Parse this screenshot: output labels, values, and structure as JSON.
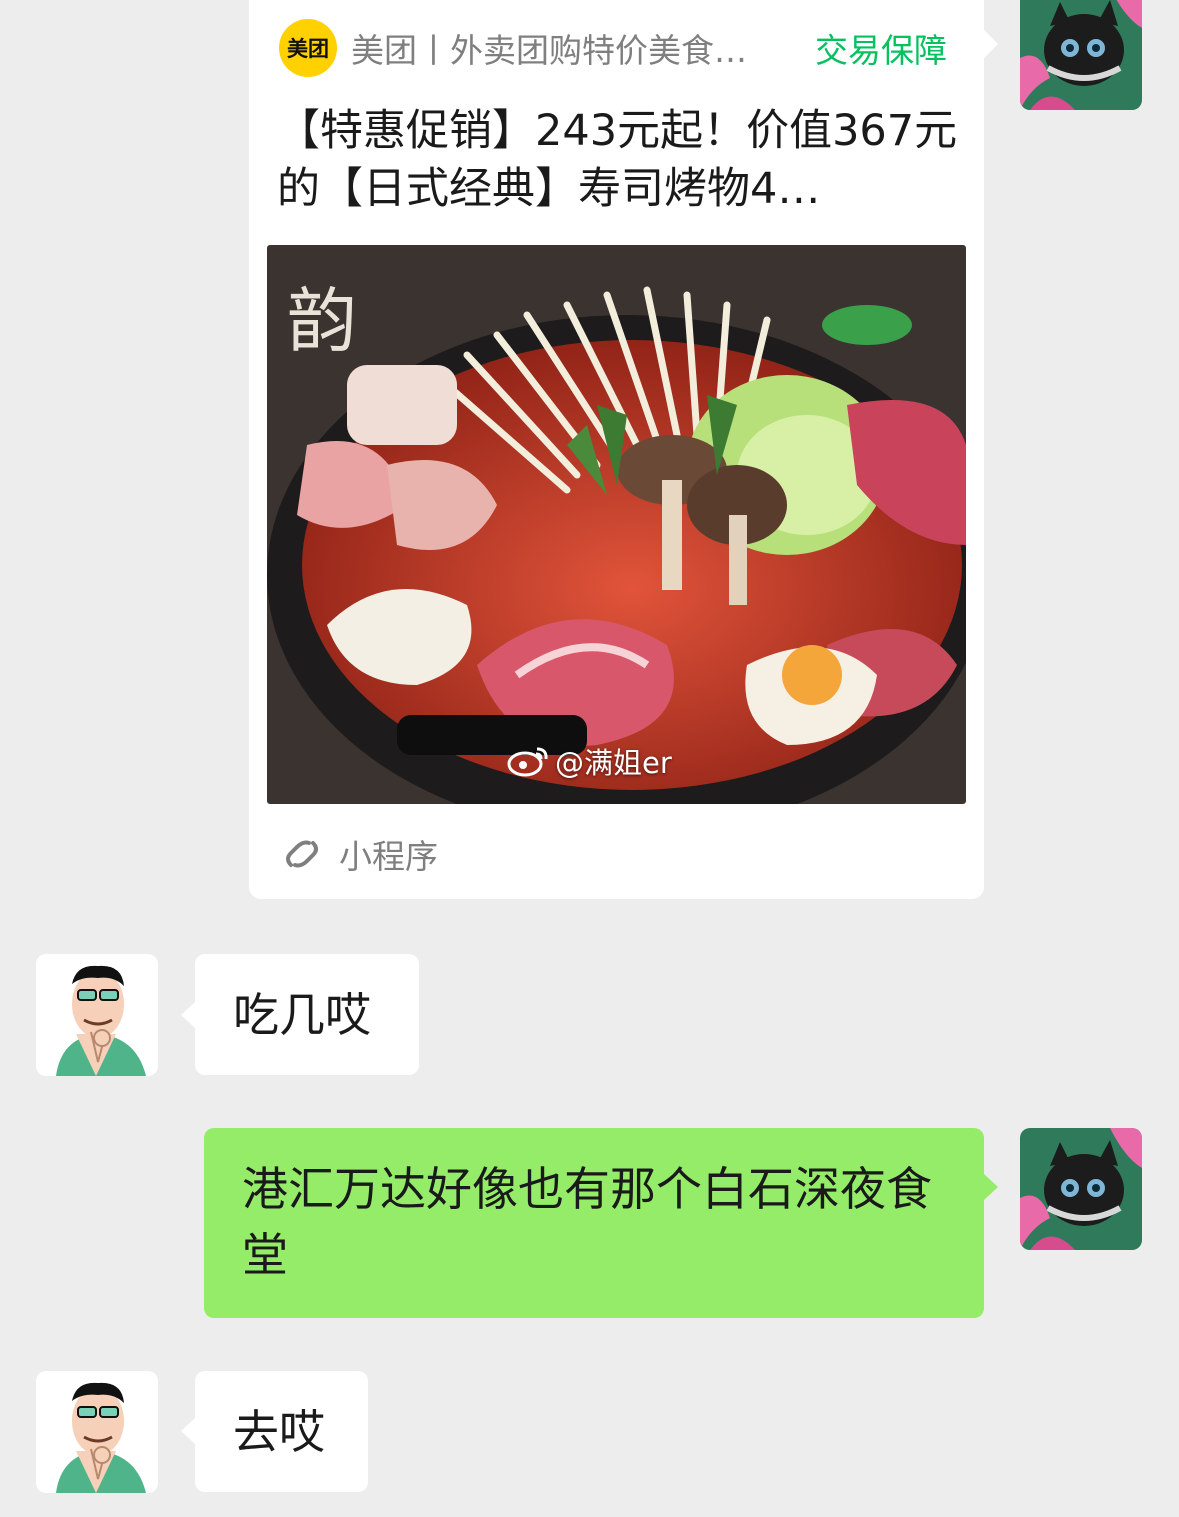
{
  "card": {
    "source_logo_text": "美团",
    "source_name": "美团丨外卖团购特价美食…",
    "guarantee_label": "交易保障",
    "title": "【特惠促销】243元起！价值367元的【日式经典】寿司烤物4…",
    "image_watermark": "@满姐er",
    "footer_label": "小程序"
  },
  "messages": [
    {
      "sender": "other",
      "text": "吃几哎"
    },
    {
      "sender": "self",
      "text": "港汇万达好像也有那个白石深夜食堂"
    },
    {
      "sender": "other",
      "text": "去哎"
    }
  ],
  "colors": {
    "background": "#ededed",
    "self_bubble": "#95ec69",
    "other_bubble": "#ffffff",
    "guarantee_green": "#07c160",
    "meituan_yellow": "#ffd100"
  },
  "icons": {
    "mini_program": "mini-program-link-icon",
    "weibo": "weibo-icon"
  }
}
